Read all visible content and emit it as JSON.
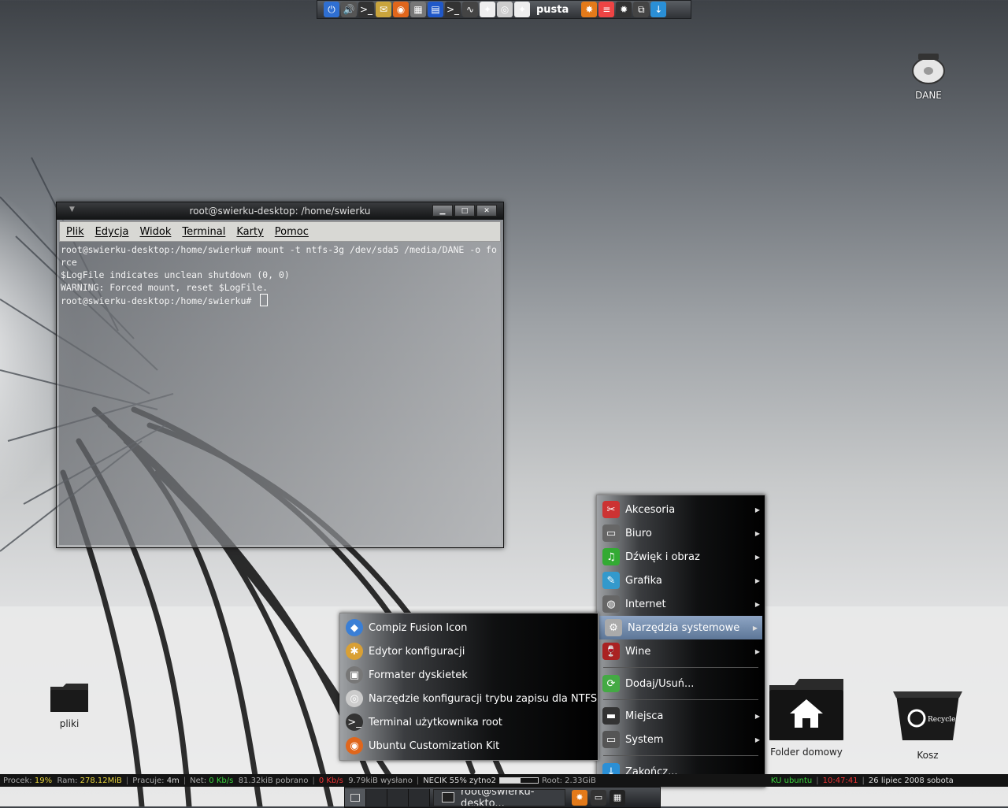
{
  "top_panel": {
    "launchers": [
      {
        "icon": "power-icon",
        "glyph": "⏻",
        "color": "#2f6fd1"
      },
      {
        "icon": "volume-icon",
        "glyph": "🔊",
        "color": "#555"
      },
      {
        "icon": "terminal-icon",
        "glyph": ">_",
        "color": "#333"
      },
      {
        "icon": "mail-icon",
        "glyph": "✉",
        "color": "#c9a43c"
      },
      {
        "icon": "firefox-icon",
        "glyph": "◉",
        "color": "#e0661c"
      },
      {
        "icon": "calculator-icon",
        "glyph": "▦",
        "color": "#777"
      },
      {
        "icon": "workspace-icon",
        "glyph": "▤",
        "color": "#2058c8"
      },
      {
        "icon": "terminal2-icon",
        "glyph": ">_",
        "color": "#333"
      },
      {
        "icon": "system-monitor-icon",
        "glyph": "∿",
        "color": "#444"
      },
      {
        "icon": "document-icon",
        "glyph": "✦",
        "color": "#eee"
      },
      {
        "icon": "disc-icon",
        "glyph": "◎",
        "color": "#ccc"
      },
      {
        "icon": "document2-icon",
        "glyph": "✦",
        "color": "#eee"
      }
    ],
    "pusta_label": "pusta",
    "right_launchers": [
      {
        "icon": "update-icon",
        "glyph": "✸",
        "color": "#e37a1a"
      },
      {
        "icon": "app-icon",
        "glyph": "≡",
        "color": "#e44"
      },
      {
        "icon": "settings-icon",
        "glyph": "✹",
        "color": "#333"
      },
      {
        "icon": "network-icon",
        "glyph": "⧉",
        "color": "#444"
      },
      {
        "icon": "download-icon",
        "glyph": "↓",
        "color": "#2a8fd6"
      }
    ]
  },
  "desktop": {
    "dane_label": "DANE",
    "pliki_label": "pliki",
    "home_label": "Folder domowy",
    "trash_label": "Kosz"
  },
  "terminal": {
    "title": "root@swierku-desktop: /home/swierku",
    "menu": [
      "Plik",
      "Edycja",
      "Widok",
      "Terminal",
      "Karty",
      "Pomoc"
    ],
    "lines": [
      "root@swierku-desktop:/home/swierku# mount -t ntfs-3g /dev/sda5 /media/DANE -o force",
      "$LogFile indicates unclean shutdown (0, 0)",
      "WARNING: Forced mount, reset $LogFile.",
      "root@swierku-desktop:/home/swierku# "
    ]
  },
  "main_menu": {
    "items": [
      {
        "label": "Akcesoria",
        "icon": "accessories-icon",
        "glyph": "✂",
        "color": "#c33",
        "submenu": true
      },
      {
        "label": "Biuro",
        "icon": "office-icon",
        "glyph": "▭",
        "color": "#666",
        "submenu": true
      },
      {
        "label": "Dźwięk i obraz",
        "icon": "multimedia-icon",
        "glyph": "♫",
        "color": "#3a3",
        "submenu": true
      },
      {
        "label": "Grafika",
        "icon": "graphics-icon",
        "glyph": "✎",
        "color": "#39c",
        "submenu": true
      },
      {
        "label": "Internet",
        "icon": "internet-icon",
        "glyph": "◍",
        "color": "#666",
        "submenu": true
      },
      {
        "label": "Narzędzia systemowe",
        "icon": "system-tools-icon",
        "glyph": "⚙",
        "color": "#aaa",
        "submenu": true,
        "selected": true
      },
      {
        "label": "Wine",
        "icon": "wine-icon",
        "glyph": "🍷",
        "color": "#a22",
        "submenu": true
      }
    ],
    "add_remove": {
      "label": "Dodaj/Usuń...",
      "icon": "add-remove-icon",
      "glyph": "⟳",
      "color": "#4a4"
    },
    "places": {
      "label": "Miejsca",
      "icon": "places-icon",
      "glyph": "▬",
      "color": "#333"
    },
    "system": {
      "label": "System",
      "icon": "system-icon",
      "glyph": "▭",
      "color": "#555"
    },
    "quit": {
      "label": "Zakończ...",
      "icon": "quit-icon",
      "glyph": "↓",
      "color": "#2a8fd6"
    }
  },
  "sub_menu": {
    "items": [
      {
        "label": "Compiz Fusion Icon",
        "icon": "compiz-icon",
        "glyph": "◆",
        "color": "#3a7fd6"
      },
      {
        "label": "Edytor konfiguracji",
        "icon": "config-editor-icon",
        "glyph": "✱",
        "color": "#d9a035"
      },
      {
        "label": "Formater dyskietek",
        "icon": "floppy-icon",
        "glyph": "▣",
        "color": "#777"
      },
      {
        "label": "Narzędzie konfiguracji trybu zapisu dla NTFS",
        "icon": "ntfs-config-icon",
        "glyph": "◎",
        "color": "#ccc"
      },
      {
        "label": "Terminal użytkownika root",
        "icon": "root-terminal-icon",
        "glyph": ">_",
        "color": "#333"
      },
      {
        "label": "Ubuntu Customization Kit",
        "icon": "uck-icon",
        "glyph": "◉",
        "color": "#e0661c"
      }
    ]
  },
  "statusbar": {
    "procek_label": "Procek:",
    "procek_value": "19%",
    "ram_label": "Ram:",
    "ram_value": "278.12MiB",
    "pracuje_label": "Pracuje:",
    "pracuje_value": "4m",
    "net_label": "Net:",
    "net_down": "0 Kb/s",
    "net_down_total": "81.32kiB pobrano",
    "net_up": "0 Kb/s",
    "net_up_total": "9.79kiB wysłano",
    "necik": "NECIK 55% zytno2",
    "necik_bar": 0.55,
    "root_label": "Root: 2.33GiB",
    "ku_ubuntu": "KU ubuntu",
    "time": "10:47:41",
    "date": "26 lipiec 2008 sobota"
  },
  "taskbar": {
    "task_label": "root@swierku-deskto...",
    "tray": [
      {
        "icon": "update-tray-icon",
        "glyph": "✸",
        "color": "#e37a1a"
      },
      {
        "icon": "monitor-tray-icon",
        "glyph": "▭",
        "color": "#333"
      },
      {
        "icon": "box-tray-icon",
        "glyph": "▦",
        "color": "#222"
      }
    ]
  }
}
